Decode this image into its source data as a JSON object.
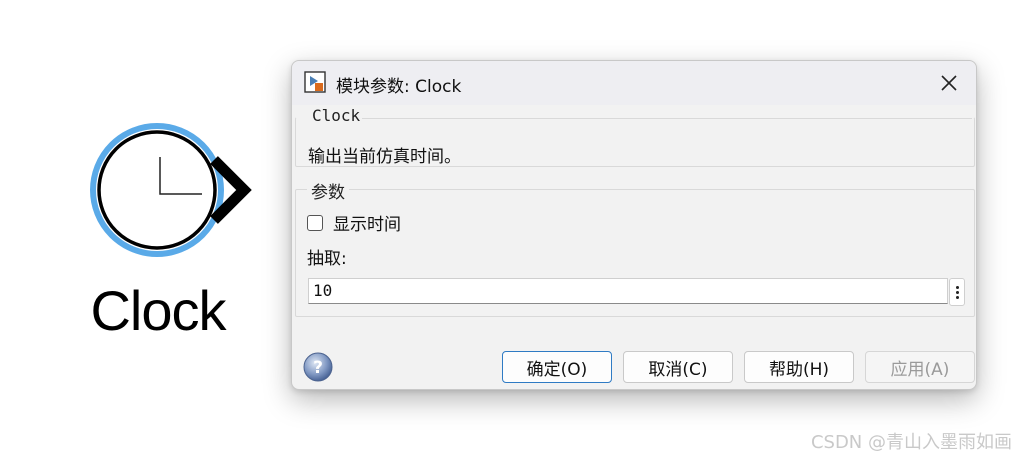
{
  "block": {
    "caption": "Clock",
    "ring_color": "#5aaae8"
  },
  "dialog": {
    "title": "模块参数: Clock",
    "block_group_title": "Clock",
    "description": "输出当前仿真时间。",
    "params_group_title": "参数",
    "show_time_label": "显示时间",
    "show_time_checked": false,
    "decimation_label": "抽取:",
    "decimation_value": "10",
    "buttons": {
      "ok": "确定(O)",
      "cancel": "取消(C)",
      "help": "帮助(H)",
      "apply": "应用(A)"
    },
    "accent_color": "#2f7bc4"
  },
  "watermark": "CSDN @青山入墨雨如画"
}
